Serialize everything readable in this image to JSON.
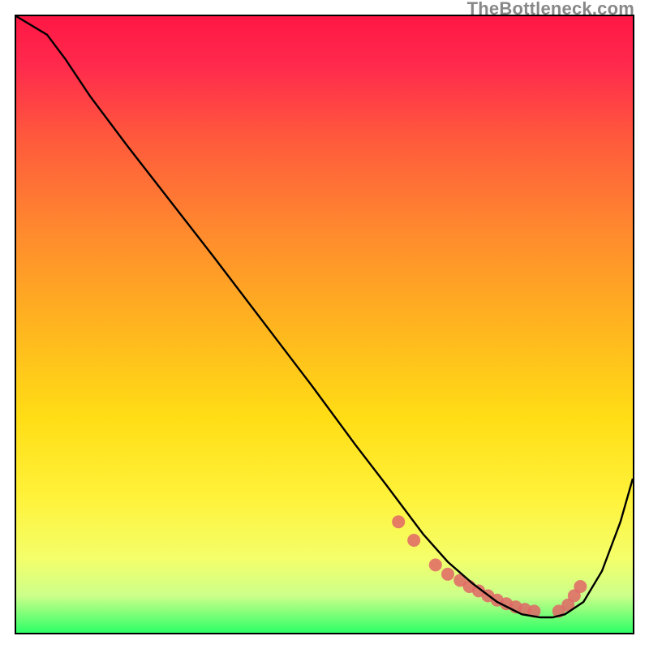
{
  "watermark": "TheBottleneck.com",
  "chart_data": {
    "type": "line",
    "title": "",
    "xlabel": "",
    "ylabel": "",
    "xlim": [
      0,
      100
    ],
    "ylim": [
      0,
      100
    ],
    "series": [
      {
        "name": "bottleneck-curve",
        "x": [
          0,
          5,
          8,
          12,
          18,
          25,
          32,
          40,
          48,
          55,
          60,
          63,
          66,
          70,
          74,
          78,
          82,
          85,
          87,
          89,
          92,
          95,
          98,
          100
        ],
        "y": [
          100,
          97,
          93,
          87,
          79,
          70,
          61,
          50.5,
          40,
          30.5,
          24,
          20,
          16,
          11.5,
          8,
          5,
          3,
          2.5,
          2.5,
          3,
          5,
          10,
          18,
          25
        ]
      }
    ],
    "green_band_y": [
      0,
      4
    ],
    "markers": {
      "name": "highlight-points",
      "color": "#e06666",
      "x": [
        62,
        64.5,
        68,
        70,
        72,
        73.5,
        75,
        76.5,
        78,
        79.5,
        81,
        82.5,
        84,
        88,
        89.5,
        90.5,
        91.5
      ],
      "y": [
        18.0,
        15.0,
        11.0,
        9.5,
        8.5,
        7.5,
        6.8,
        6.0,
        5.3,
        4.7,
        4.2,
        3.8,
        3.5,
        3.5,
        4.5,
        6.0,
        7.5
      ]
    }
  }
}
